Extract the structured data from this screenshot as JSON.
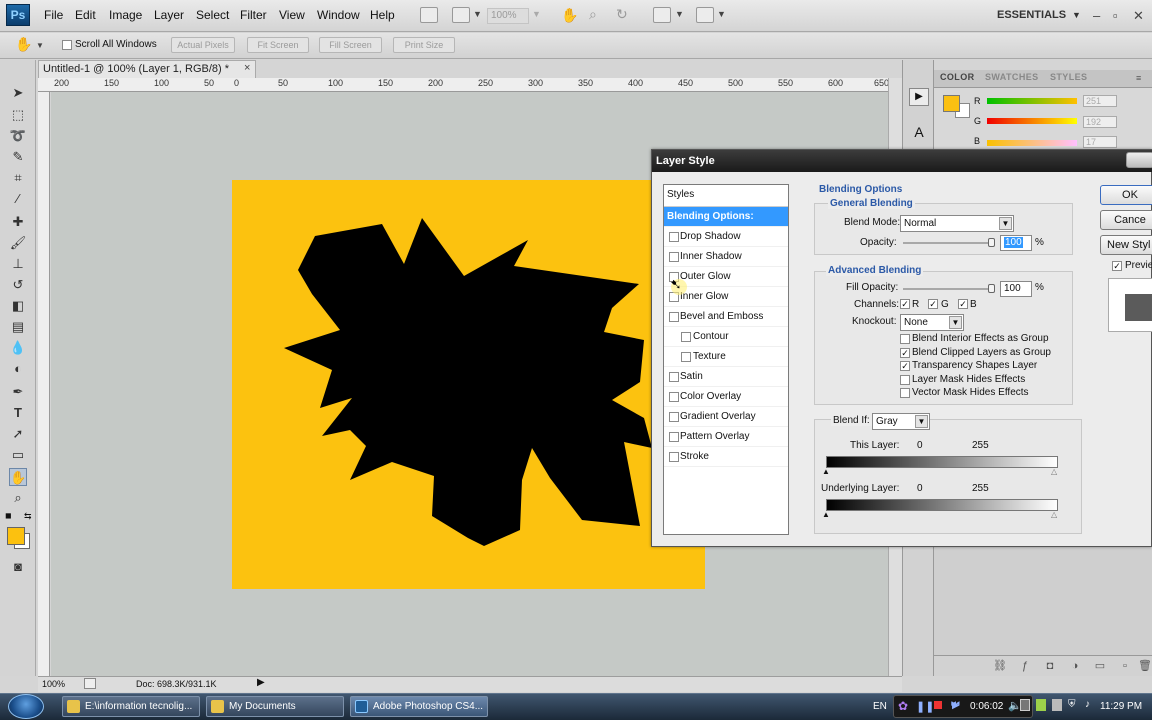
{
  "app": {
    "logo": "Ps",
    "menu": [
      "File",
      "Edit",
      "Image",
      "Layer",
      "Select",
      "Filter",
      "View",
      "Window",
      "Help"
    ],
    "zoom": "100%",
    "workspace": "ESSENTIALS",
    "window_controls": [
      "–",
      "▫",
      "✕"
    ]
  },
  "options": {
    "scroll_all": "Scroll All Windows",
    "buttons": [
      "Actual Pixels",
      "Fit Screen",
      "Fill Screen",
      "Print Size"
    ]
  },
  "document": {
    "tab_title": "Untitled-1 @ 100% (Layer 1, RGB/8) *",
    "close": "×",
    "ruler_numbers": [
      "200",
      "150",
      "100",
      "50",
      "0",
      "50",
      "100",
      "150",
      "200",
      "250",
      "300",
      "350",
      "400",
      "450",
      "500",
      "550",
      "600",
      "650"
    ],
    "status_zoom": "100%",
    "status_doc": "Doc: 698.3K/931.1K",
    "canvas_color": "#fcc20f"
  },
  "panels": {
    "tabs": [
      "COLOR",
      "SWATCHES",
      "STYLES"
    ],
    "channels": [
      {
        "label": "R",
        "value": "251"
      },
      {
        "label": "G",
        "value": "192"
      },
      {
        "label": "B",
        "value": "17"
      }
    ],
    "foreground": "#fbc011"
  },
  "dialog": {
    "title": "Layer Style",
    "styles_header": "Styles",
    "styles": [
      {
        "label": "Blending Options: Default",
        "selected": true,
        "check": false,
        "sub": false
      },
      {
        "label": "Drop Shadow",
        "selected": false,
        "check": true,
        "sub": false
      },
      {
        "label": "Inner Shadow",
        "selected": false,
        "check": true,
        "sub": false
      },
      {
        "label": "Outer Glow",
        "selected": false,
        "check": true,
        "sub": false
      },
      {
        "label": "Inner Glow",
        "selected": false,
        "check": true,
        "sub": false
      },
      {
        "label": "Bevel and Emboss",
        "selected": false,
        "check": true,
        "sub": false
      },
      {
        "label": "Contour",
        "selected": false,
        "check": true,
        "sub": true
      },
      {
        "label": "Texture",
        "selected": false,
        "check": true,
        "sub": true
      },
      {
        "label": "Satin",
        "selected": false,
        "check": true,
        "sub": false
      },
      {
        "label": "Color Overlay",
        "selected": false,
        "check": true,
        "sub": false
      },
      {
        "label": "Gradient Overlay",
        "selected": false,
        "check": true,
        "sub": false
      },
      {
        "label": "Pattern Overlay",
        "selected": false,
        "check": true,
        "sub": false
      },
      {
        "label": "Stroke",
        "selected": false,
        "check": true,
        "sub": false
      }
    ],
    "blending_options": "Blending Options",
    "general_blending": "General Blending",
    "blend_mode_label": "Blend Mode:",
    "blend_mode": "Normal",
    "opacity_label": "Opacity:",
    "opacity": "100",
    "percent": "%",
    "advanced_blending": "Advanced Blending",
    "fill_opacity_label": "Fill Opacity:",
    "fill_opacity": "100",
    "channels_label": "Channels:",
    "channel_r": "R",
    "channel_g": "G",
    "channel_b": "B",
    "knockout_label": "Knockout:",
    "knockout": "None",
    "checks": [
      {
        "label": "Blend Interior Effects as Group",
        "checked": false
      },
      {
        "label": "Blend Clipped Layers as Group",
        "checked": true
      },
      {
        "label": "Transparency Shapes Layer",
        "checked": true
      },
      {
        "label": "Layer Mask Hides Effects",
        "checked": false
      },
      {
        "label": "Vector Mask Hides Effects",
        "checked": false
      }
    ],
    "blend_if_label": "Blend If:",
    "blend_if": "Gray",
    "this_layer_label": "This Layer:",
    "this_layer_min": "0",
    "this_layer_max": "255",
    "underlying_label": "Underlying Layer:",
    "underlying_min": "0",
    "underlying_max": "255",
    "ok": "OK",
    "cancel": "Cance",
    "new_style": "New Styl",
    "preview": "Previe"
  },
  "taskbar": {
    "tasks": [
      {
        "label": "E:\\information tecnolig...",
        "active": false
      },
      {
        "label": "My Documents",
        "active": false
      },
      {
        "label": "Adobe Photoshop CS4...",
        "active": true
      }
    ],
    "lang": "EN",
    "media_time": "0:06:02",
    "clock": "11:29 PM"
  }
}
